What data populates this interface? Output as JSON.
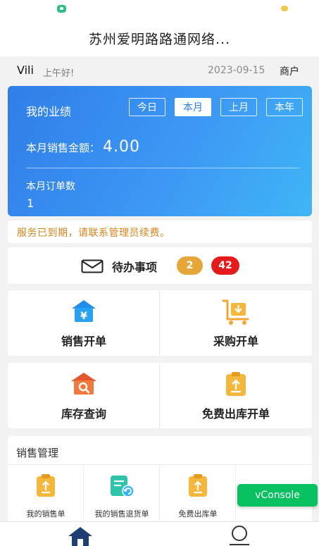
{
  "header": {
    "title": "苏州爱明路路通网络..."
  },
  "greeting": {
    "name": "Vili",
    "hello": "上午好!",
    "date": "2023-09-15",
    "role": "商户"
  },
  "performance": {
    "title": "我的业绩",
    "tabs": [
      "今日",
      "本月",
      "上月",
      "本年"
    ],
    "active_tab": "本月",
    "amount_label": "本月销售金额：",
    "amount_value": "4.00",
    "orders_label": "本月订单数",
    "orders_value": "1"
  },
  "notice": "服务已到期，请联系管理员续费。",
  "todo": {
    "label": "待办事项",
    "badge_1": "2",
    "badge_2": "42"
  },
  "quick_actions": [
    {
      "label": "销售开单",
      "icon": "sales-order-icon"
    },
    {
      "label": "采购开单",
      "icon": "purchase-cart-icon"
    },
    {
      "label": "库存查询",
      "icon": "inventory-search-icon"
    },
    {
      "label": "免费出库开单",
      "icon": "free-outbound-icon"
    }
  ],
  "sales_management": {
    "title": "销售管理",
    "items": [
      {
        "label": "我的销售单",
        "icon": "clipboard-upload-icon"
      },
      {
        "label": "我的销售退货单",
        "icon": "clipboard-return-icon"
      },
      {
        "label": "免费出库单",
        "icon": "clipboard-upload-icon"
      }
    ]
  },
  "vconsole_label": "vConsole",
  "colors": {
    "primary": "#2f7ee8",
    "accent_orange": "#e5a73a",
    "badge_red": "#e51b1b",
    "warning_text": "#d8841c",
    "vconsole_green": "#07c160"
  },
  "tabbar": {
    "icons": [
      "home-icon",
      "profile-icon"
    ]
  }
}
